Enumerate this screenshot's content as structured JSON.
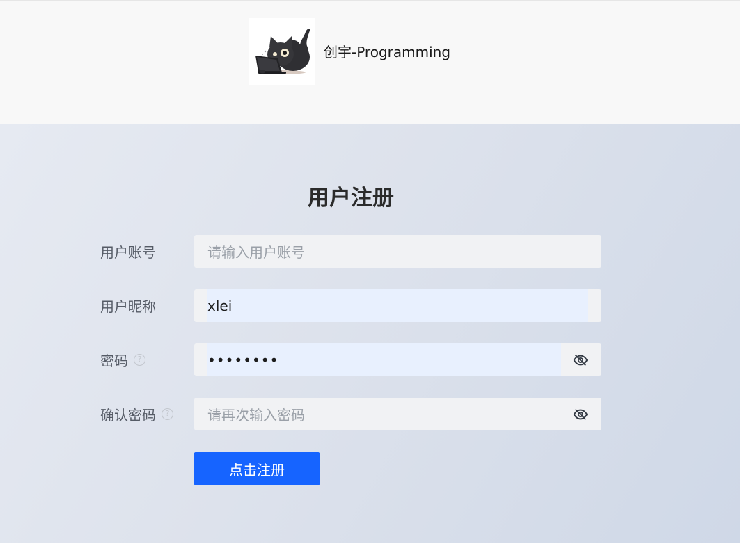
{
  "header": {
    "brand_name": "创宇-Programming"
  },
  "form": {
    "title": "用户注册",
    "fields": [
      {
        "label": "用户账号",
        "value": "",
        "placeholder": "请输入用户账号",
        "has_help": false,
        "has_eye": false
      },
      {
        "label": "用户昵称",
        "value": "xlei",
        "placeholder": "",
        "has_help": false,
        "has_eye": false
      },
      {
        "label": "密码",
        "value": "••••••••",
        "placeholder": "",
        "has_help": true,
        "has_eye": true
      },
      {
        "label": "确认密码",
        "value": "",
        "placeholder": "请再次输入密码",
        "has_help": true,
        "has_eye": true
      }
    ],
    "help_glyph": "?",
    "submit_label": "点击注册"
  },
  "icons": {
    "logo": "cat-with-laptop-logo",
    "help": "question-circle-icon",
    "eye": "eye-slash-icon"
  },
  "colors": {
    "primary": "#1664ff",
    "header_bg": "#f8f8f8",
    "input_bg": "#f1f2f4",
    "autofill_bg": "#e8f0fe"
  }
}
